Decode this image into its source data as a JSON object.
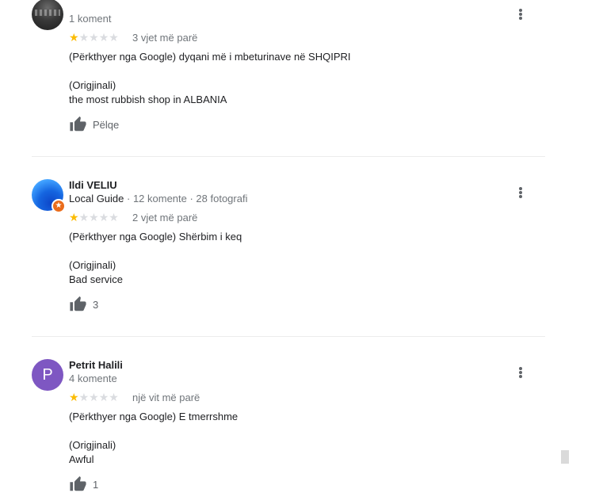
{
  "reviews": [
    {
      "name": "",
      "meta_count": "1 koment",
      "time": "3 vjet më parë",
      "translated": "(Përkthyer nga Google) dyqani më i mbeturinave në SHQIPRI",
      "original_label": "(Origjinali)",
      "original": "the most rubbish shop in ALBANIA",
      "like_label": "Pëlqe",
      "rating": 1
    },
    {
      "name": "Ildi VELIU",
      "local_guide": "Local Guide",
      "meta_stats": " · 12 komente · 28 fotografi",
      "time": "2 vjet më parë",
      "translated": "(Përkthyer nga Google) Shërbim i keq",
      "original_label": "(Origjinali)",
      "original": "Bad service",
      "like_label": "3",
      "rating": 1
    },
    {
      "name": "Petrit Halili",
      "avatar_letter": "P",
      "meta_count": "4 komente",
      "time": "një vit më parë",
      "translated": "(Përkthyer nga Google) E tmerrshme",
      "original_label": "(Origjinali)",
      "original": "Awful",
      "like_label": "1",
      "rating": 1
    }
  ],
  "stars": {
    "filled": "★",
    "empty": "★"
  },
  "colors": {
    "star": "#fbbc04",
    "star_empty": "#dadce0",
    "avatar_petrit": "#7e57c2",
    "local_guide_badge": "#ea6c1b"
  },
  "icons": {
    "thumb": "thumb-up-icon",
    "more": "more-vert-icon",
    "badge": "local-guide-star-icon"
  }
}
